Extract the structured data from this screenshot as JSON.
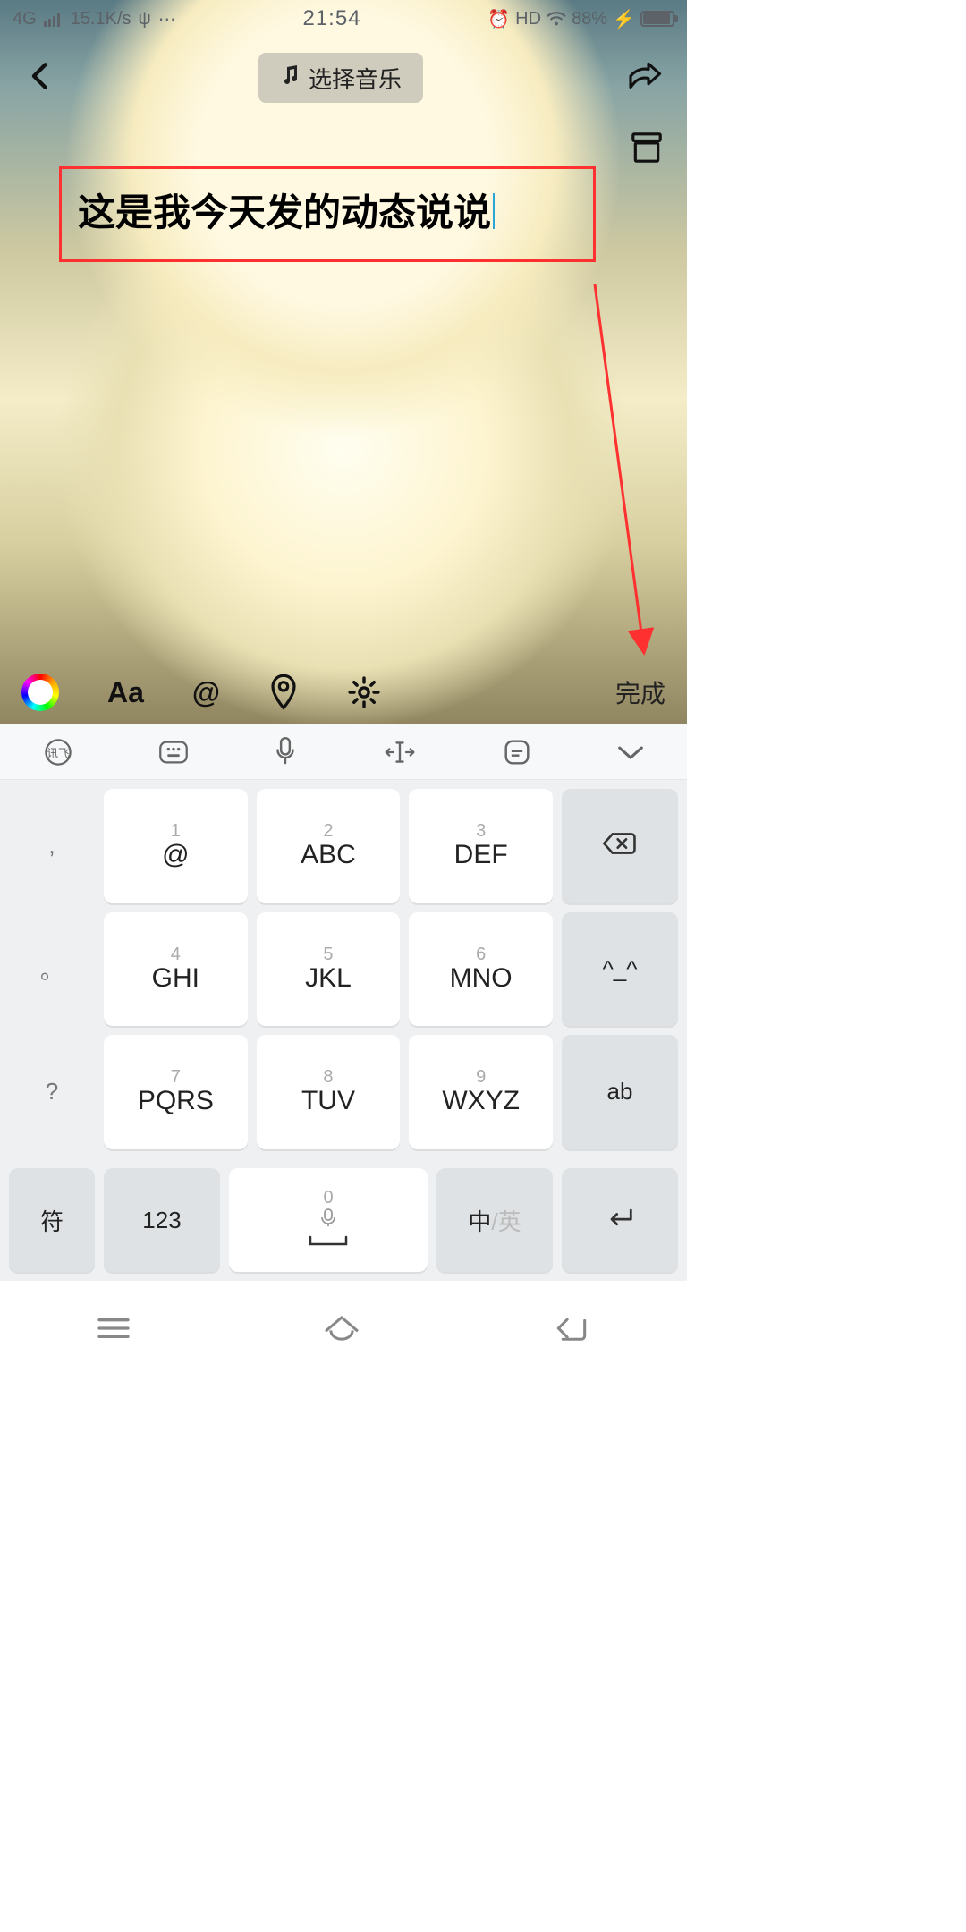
{
  "status": {
    "net": "4G",
    "speed": "15.1K/s",
    "time": "21:54",
    "hd": "HD",
    "battery": "88%"
  },
  "header": {
    "music": "选择音乐"
  },
  "editor": {
    "text": "这是我今天发的动态说说"
  },
  "toolbar": {
    "font": "Aa",
    "at": "@",
    "done": "完成"
  },
  "keyboard": {
    "side": [
      ",",
      "。",
      "?",
      "!"
    ],
    "keys": [
      {
        "n": "1",
        "l": "@"
      },
      {
        "n": "2",
        "l": "ABC"
      },
      {
        "n": "3",
        "l": "DEF"
      },
      {
        "n": "4",
        "l": "GHI"
      },
      {
        "n": "5",
        "l": "JKL"
      },
      {
        "n": "6",
        "l": "MNO"
      },
      {
        "n": "7",
        "l": "PQRS"
      },
      {
        "n": "8",
        "l": "TUV"
      },
      {
        "n": "9",
        "l": "WXYZ"
      }
    ],
    "right": [
      "",
      "^_^",
      "ab"
    ],
    "bottom": {
      "sym": "符",
      "num": "123",
      "space_n": "0",
      "cn": "中",
      "en": "/英"
    }
  }
}
